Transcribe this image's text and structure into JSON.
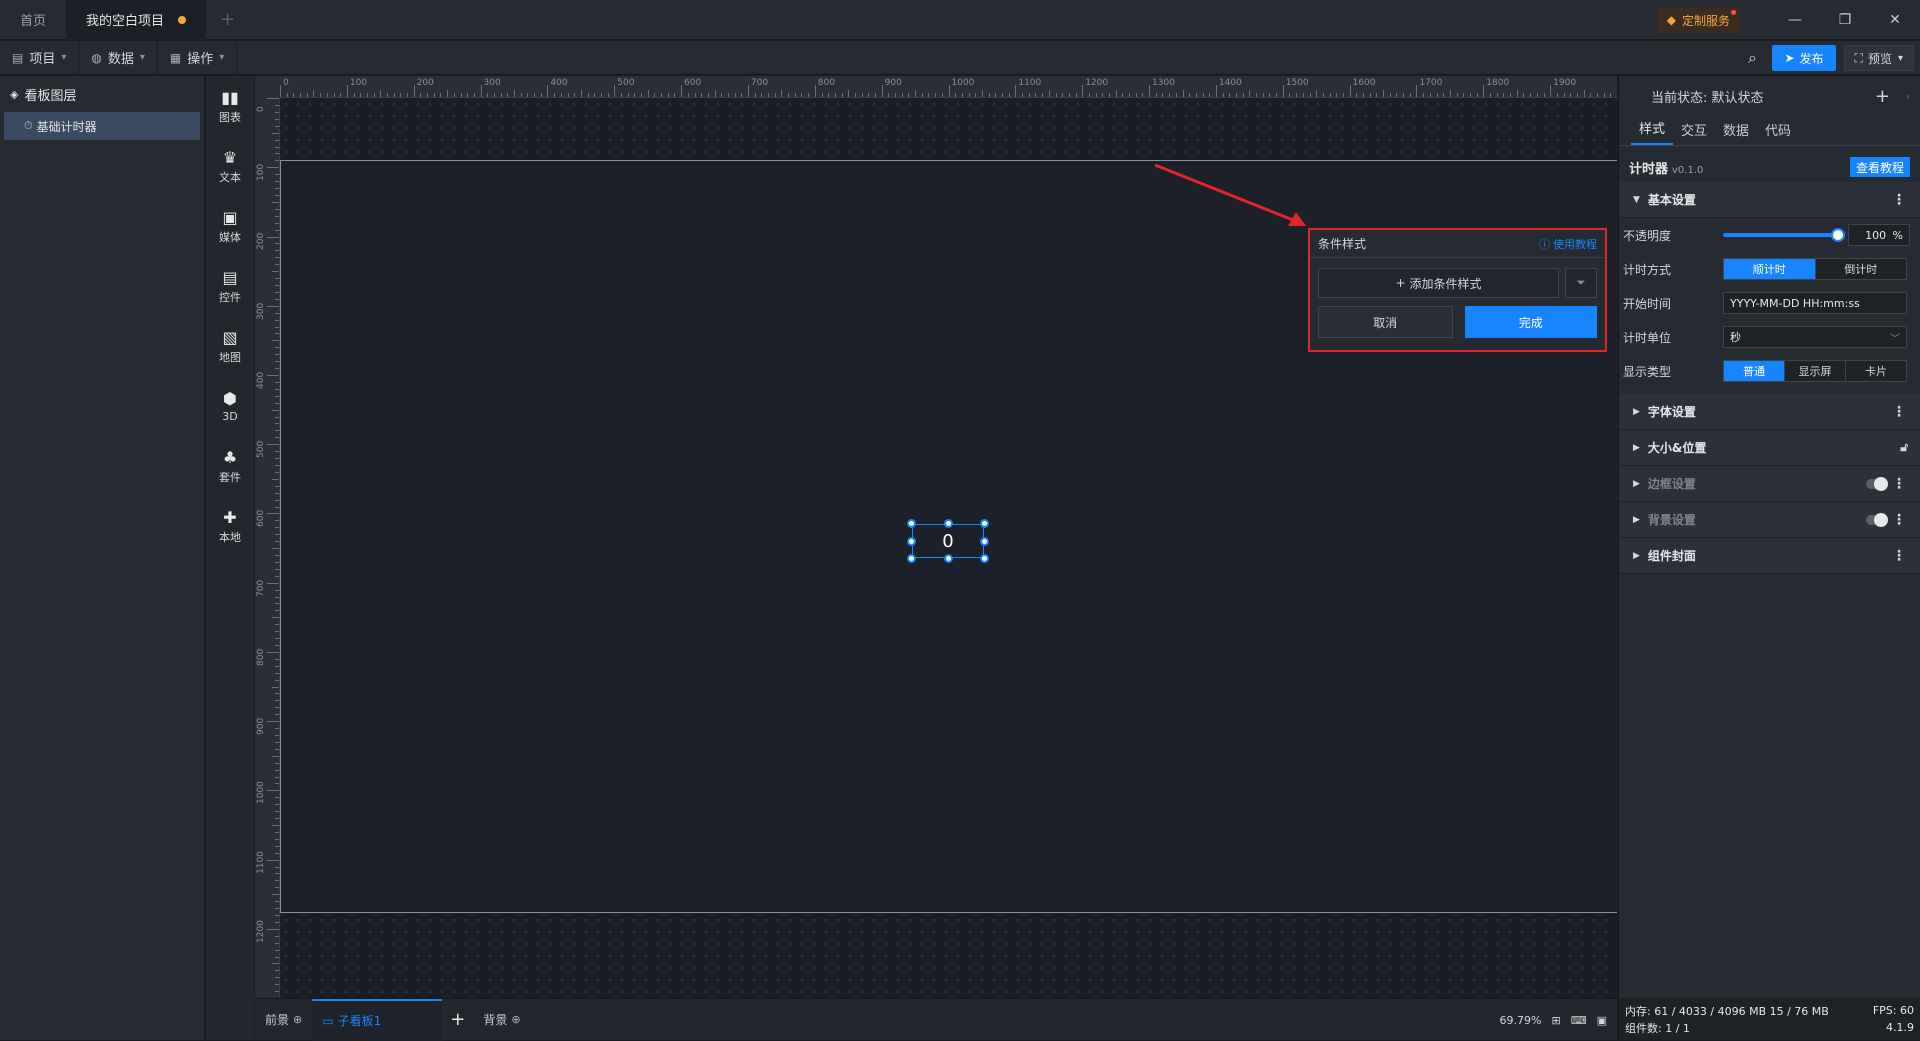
{
  "titlebar": {
    "tabs": [
      {
        "label": "首页",
        "active": false
      },
      {
        "label": "我的空白项目",
        "active": true,
        "unsaved": true
      }
    ],
    "custom_service": "定制服务",
    "icons": [
      "tab-add-icon",
      "gem-icon",
      "minimize-icon",
      "maximize-icon",
      "close-icon"
    ]
  },
  "toolbar": {
    "menus": [
      {
        "label": "项目",
        "icon": "file-icon"
      },
      {
        "label": "数据",
        "icon": "database-icon"
      },
      {
        "label": "操作",
        "icon": "grid-icon"
      }
    ],
    "publish_label": "发布",
    "preview_label": "预览"
  },
  "layers": {
    "title": "看板图层",
    "items": [
      {
        "label": "基础计时器",
        "icon": "timer-icon"
      }
    ]
  },
  "rail": {
    "items": [
      {
        "label": "图表",
        "icon": "chart-icon"
      },
      {
        "label": "文本",
        "icon": "text-icon"
      },
      {
        "label": "媒体",
        "icon": "media-icon"
      },
      {
        "label": "控件",
        "icon": "control-icon"
      },
      {
        "label": "地图",
        "icon": "map-icon"
      },
      {
        "label": "3D",
        "icon": "cube-icon"
      },
      {
        "label": "套件",
        "icon": "kit-icon"
      },
      {
        "label": "本地",
        "icon": "puzzle-icon"
      }
    ]
  },
  "canvas": {
    "ruler_top_labels": [
      "0",
      "100",
      "200",
      "300",
      "400",
      "500",
      "600",
      "700",
      "800",
      "900",
      "1000",
      "1100",
      "1200",
      "1300",
      "1400",
      "1500",
      "1600",
      "1700",
      "1800",
      "1900"
    ],
    "ruler_left_labels": [
      "0",
      "100",
      "200",
      "300",
      "400",
      "500",
      "600",
      "700",
      "800",
      "900",
      "1000",
      "1100",
      "1200"
    ],
    "timer_value": "0"
  },
  "popup": {
    "title": "条件样式",
    "help_label": "使用教程",
    "add_label": "添加条件样式",
    "cancel_label": "取消",
    "done_label": "完成"
  },
  "bottombar": {
    "foreground": "前景",
    "sub_board": "子看板1",
    "background": "背景",
    "zoom": "69.79%"
  },
  "props": {
    "state_label": "当前状态:",
    "state_value": "默认状态",
    "tabs": [
      {
        "label": "样式",
        "active": true
      },
      {
        "label": "交互",
        "active": false
      },
      {
        "label": "数据",
        "active": false
      },
      {
        "label": "代码",
        "active": false
      }
    ],
    "component_name": "计时器",
    "component_version": "v0.1.0",
    "tutorial_label": "查看教程",
    "basic_section": "基本设置",
    "opacity_label": "不透明度",
    "opacity_value": "100",
    "opacity_unit": "%",
    "opacity_level": 1.0,
    "timing_mode_label": "计时方式",
    "timing_mode_options": [
      "顺计时",
      "倒计时"
    ],
    "timing_mode_selected": "顺计时",
    "start_time_label": "开始时间",
    "start_time_value": "YYYY-MM-DD HH:mm:ss",
    "unit_label": "计时单位",
    "unit_value": "秒",
    "display_type_label": "显示类型",
    "display_type_options": [
      "普通",
      "显示屏",
      "卡片"
    ],
    "display_type_selected": "普通",
    "sections": [
      {
        "label": "字体设置",
        "dim": false,
        "kind": "more"
      },
      {
        "label": "大小&位置",
        "dim": false,
        "kind": "lock"
      },
      {
        "label": "边框设置",
        "dim": true,
        "kind": "toggle"
      },
      {
        "label": "背景设置",
        "dim": true,
        "kind": "toggle"
      },
      {
        "label": "组件封面",
        "dim": false,
        "kind": "more"
      }
    ]
  },
  "status": {
    "memory": "内存: 61 / 4033 / 4096 MB  15 / 76 MB",
    "fps": "FPS: 60",
    "components": "组件数: 1 / 1",
    "version": "4.1.9"
  },
  "colors": {
    "accent": "#1785ff",
    "highlight_red": "#e0262b",
    "unsaved_dot": "#f2a93b"
  }
}
